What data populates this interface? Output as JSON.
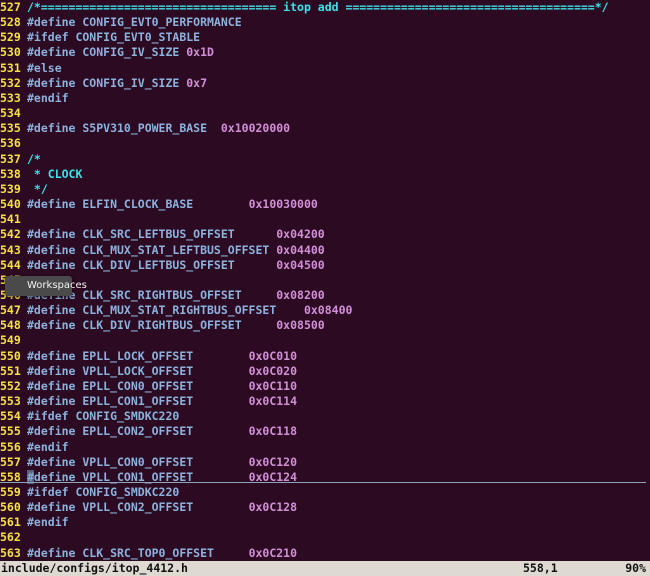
{
  "editor": {
    "lines": [
      {
        "n": "527",
        "text": "/*================================== itop add ====================================*/",
        "kind": "comment"
      },
      {
        "n": "528",
        "text": "#define CONFIG_EVT0_PERFORMANCE"
      },
      {
        "n": "529",
        "text": "#ifdef CONFIG_EVT0_STABLE"
      },
      {
        "n": "530",
        "text": "#define CONFIG_IV_SIZE ",
        "value": "0x1D"
      },
      {
        "n": "531",
        "text": "#else"
      },
      {
        "n": "532",
        "text": "#define CONFIG_IV_SIZE ",
        "value": "0x7"
      },
      {
        "n": "533",
        "text": "#endif"
      },
      {
        "n": "534",
        "text": ""
      },
      {
        "n": "535",
        "text": "#define S5PV310_POWER_BASE  ",
        "value": "0x10020000"
      },
      {
        "n": "536",
        "text": ""
      },
      {
        "n": "537",
        "text": "/*",
        "kind": "comment"
      },
      {
        "n": "538",
        "text": " * CLOCK",
        "kind": "comment"
      },
      {
        "n": "539",
        "text": " */",
        "kind": "comment"
      },
      {
        "n": "540",
        "text": "#define ELFIN_CLOCK_BASE        ",
        "value": "0x10030000"
      },
      {
        "n": "541",
        "text": ""
      },
      {
        "n": "542",
        "text": "#define CLK_SRC_LEFTBUS_OFFSET      ",
        "value": "0x04200"
      },
      {
        "n": "543",
        "text": "#define CLK_MUX_STAT_LEFTBUS_OFFSET ",
        "value": "0x04400"
      },
      {
        "n": "544",
        "text": "#define CLK_DIV_LEFTBUS_OFFSET      ",
        "value": "0x04500"
      },
      {
        "n": "545",
        "text": ""
      },
      {
        "n": "546",
        "text": "#define CLK_SRC_RIGHTBUS_OFFSET     ",
        "value": "0x08200"
      },
      {
        "n": "547",
        "text": "#define CLK_MUX_STAT_RIGHTBUS_OFFSET    ",
        "value": "0x08400"
      },
      {
        "n": "548",
        "text": "#define CLK_DIV_RIGHTBUS_OFFSET     ",
        "value": "0x08500"
      },
      {
        "n": "549",
        "text": ""
      },
      {
        "n": "550",
        "text": "#define EPLL_LOCK_OFFSET        ",
        "value": "0x0C010"
      },
      {
        "n": "551",
        "text": "#define VPLL_LOCK_OFFSET        ",
        "value": "0x0C020"
      },
      {
        "n": "552",
        "text": "#define EPLL_CON0_OFFSET        ",
        "value": "0x0C110"
      },
      {
        "n": "553",
        "text": "#define EPLL_CON1_OFFSET        ",
        "value": "0x0C114"
      },
      {
        "n": "554",
        "text": "#ifdef CONFIG_SMDKC220"
      },
      {
        "n": "555",
        "text": "#define EPLL_CON2_OFFSET        ",
        "value": "0x0C118"
      },
      {
        "n": "556",
        "text": "#endif"
      },
      {
        "n": "557",
        "text": "#define VPLL_CON0_OFFSET        ",
        "value": "0x0C120"
      },
      {
        "n": "558",
        "text": "#define VPLL_CON1_OFFSET        ",
        "value": "0x0C124",
        "current": true
      },
      {
        "n": "559",
        "text": "#ifdef CONFIG_SMDKC220"
      },
      {
        "n": "560",
        "text": "#define VPLL_CON2_OFFSET        ",
        "value": "0x0C128"
      },
      {
        "n": "561",
        "text": "#endif"
      },
      {
        "n": "562",
        "text": ""
      },
      {
        "n": "563",
        "text": "#define CLK_SRC_TOP0_OFFSET     ",
        "value": "0x0C210"
      }
    ]
  },
  "tooltip": {
    "label": "Workspaces"
  },
  "status": {
    "file": "include/configs/itop_4412.h",
    "position": "558,1",
    "percent": "90%"
  },
  "colors": {
    "background": "#2c0a22",
    "line_number": "#f7e243",
    "keyword": "#8cb2dd",
    "comment": "#3de3e8",
    "number": "#d28fd8",
    "statusbar": "#dedad2"
  }
}
